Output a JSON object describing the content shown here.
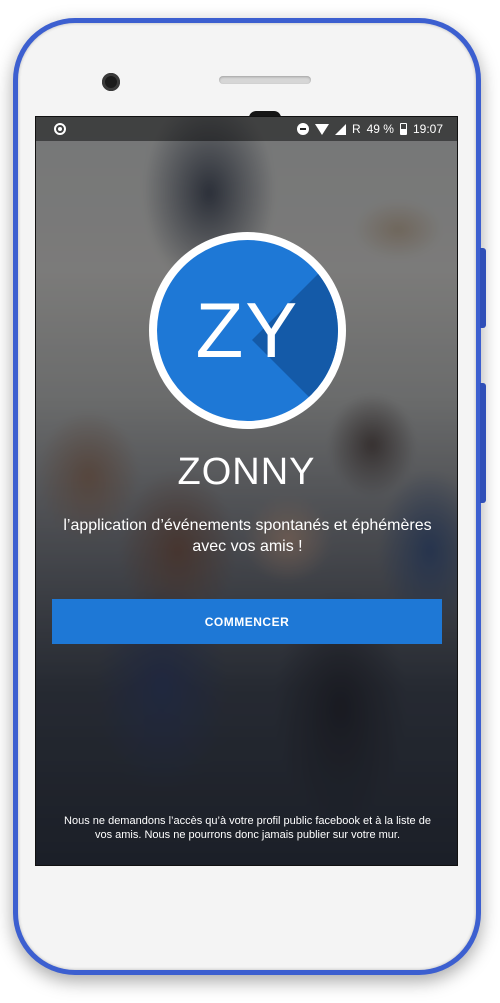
{
  "status_bar": {
    "network_label": "R",
    "battery_percent": "49 %",
    "time": "19:07"
  },
  "app": {
    "logo_text": "ZY",
    "name": "ZONNY",
    "tagline": "l’application d’événements spontanés et éphémères avec vos amis !",
    "start_button_label": "COMMENCER",
    "disclaimer": "Nous ne demandons l’accès qu’à votre profil public facebook et à la liste de vos amis. Nous ne pourrons donc jamais publier sur votre mur."
  },
  "colors": {
    "accent": "#1e78d6",
    "logo_shadow": "#145aa8",
    "device_frame": "#3c5fd0"
  }
}
